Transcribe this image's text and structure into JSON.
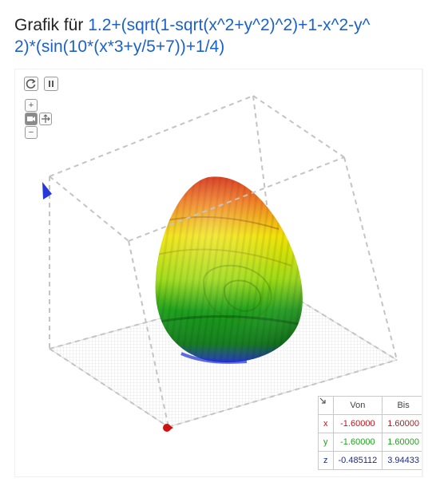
{
  "title": {
    "prefix": "Grafik für",
    "function_line1": "1.2+(sqrt(1-sqrt(x^2+y^2)^2)+1-x^2-y^",
    "function_line2": "2)*(sin(10*(x*3+y/5+7))+1/4)"
  },
  "toolbar": {
    "reset_icon": "refresh-icon",
    "pause_icon": "pause-icon",
    "zoom_in_label": "+",
    "zoom_out_label": "−",
    "camera_icon": "camera-icon",
    "move_icon": "move-arrows-icon"
  },
  "range_table": {
    "corner_icon": "arrow-down-right-icon",
    "header": {
      "from": "Von",
      "to": "Bis"
    },
    "rows": [
      {
        "axis": "x",
        "from": "-1.60000",
        "to": "1.60000",
        "color": "#c4141b"
      },
      {
        "axis": "y",
        "from": "-1.60000",
        "to": "1.60000",
        "color": "#1ea31e"
      },
      {
        "axis": "z",
        "from": "-0.485112",
        "to": "3.94433",
        "color": "#1a2a9a"
      }
    ]
  },
  "colors": {
    "function_link": "#1a62c8",
    "surface_top": "#d32a0e",
    "surface_middle": "#ece300",
    "surface_bottom": "#0a8a14",
    "surface_base": "#1d2fd6",
    "bounding_box": "#c4c4c4"
  }
}
